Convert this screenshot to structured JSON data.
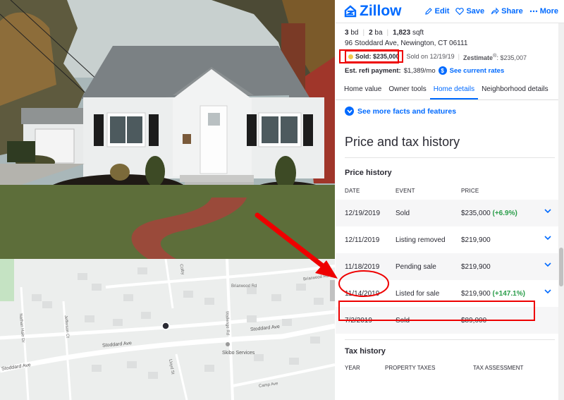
{
  "brand": {
    "name": "Zillow",
    "accent": "#006aff"
  },
  "actions": [
    {
      "label": "Edit",
      "icon": "pencil-icon"
    },
    {
      "label": "Save",
      "icon": "heart-icon"
    },
    {
      "label": "Share",
      "icon": "share-icon"
    },
    {
      "label": "More",
      "icon": "more-dots-icon"
    }
  ],
  "home": {
    "beds": "3",
    "beds_unit": "bd",
    "baths": "2",
    "baths_unit": "ba",
    "sqft": "1,823",
    "sqft_unit": "sqft",
    "address": "96 Stoddard Ave, Newington, CT 06111",
    "sold_label": "Sold: $235,000",
    "sold_on": "Sold on 12/19/19",
    "zestimate_label": "Zestimate",
    "zestimate_reg": "®",
    "zestimate_value": ": $235,007",
    "refi_label": "Est. refi payment:",
    "refi_value": "$1,389/mo",
    "refi_link": "See current rates"
  },
  "tabs": [
    "Home value",
    "Owner tools",
    "Home details",
    "Neighborhood details"
  ],
  "active_tab": "Home details",
  "more_facts": "See more facts and features",
  "price_tax": {
    "title": "Price and tax history",
    "price_history_title": "Price history",
    "columns": [
      "DATE",
      "EVENT",
      "PRICE"
    ],
    "rows": [
      {
        "date": "12/19/2019",
        "event": "Sold",
        "price": "$235,000",
        "change": "(+6.9%)"
      },
      {
        "date": "12/11/2019",
        "event": "Listing removed",
        "price": "$219,900",
        "change": ""
      },
      {
        "date": "11/18/2019",
        "event": "Pending sale",
        "price": "$219,900",
        "change": ""
      },
      {
        "date": "11/14/2019",
        "event": "Listed for sale",
        "price": "$219,900",
        "change": "(+147.1%)"
      },
      {
        "date": "7/2/2019",
        "event": "Sold",
        "price": "$89,000",
        "change": ""
      }
    ],
    "tax_history_title": "Tax history",
    "tax_columns": [
      "YEAR",
      "PROPERTY TAXES",
      "TAX ASSESSMENT"
    ]
  },
  "map": {
    "labels": {
      "briarwood_1": "Briarwood Rd",
      "briarwood_2": "Briarwood Rd",
      "colby": "Colby",
      "walnut_hill": "Walnut Hill Dr",
      "walnut": "Walnut",
      "nathan_hale": "Nathan Hale Dr",
      "jefferson": "Jefferson Ct",
      "stoddard_1": "Stoddard Ave",
      "stoddard_2": "Stoddard Ave",
      "stoddard_3": "Stoddard Ave",
      "lloyd": "Lloyd St",
      "skibo": "Skibo Services",
      "camp": "Camp Ave",
      "wallenge": "Wallenge Rd"
    }
  },
  "colors": {
    "annotation": "#e00000",
    "positive": "#2a9d4a"
  }
}
